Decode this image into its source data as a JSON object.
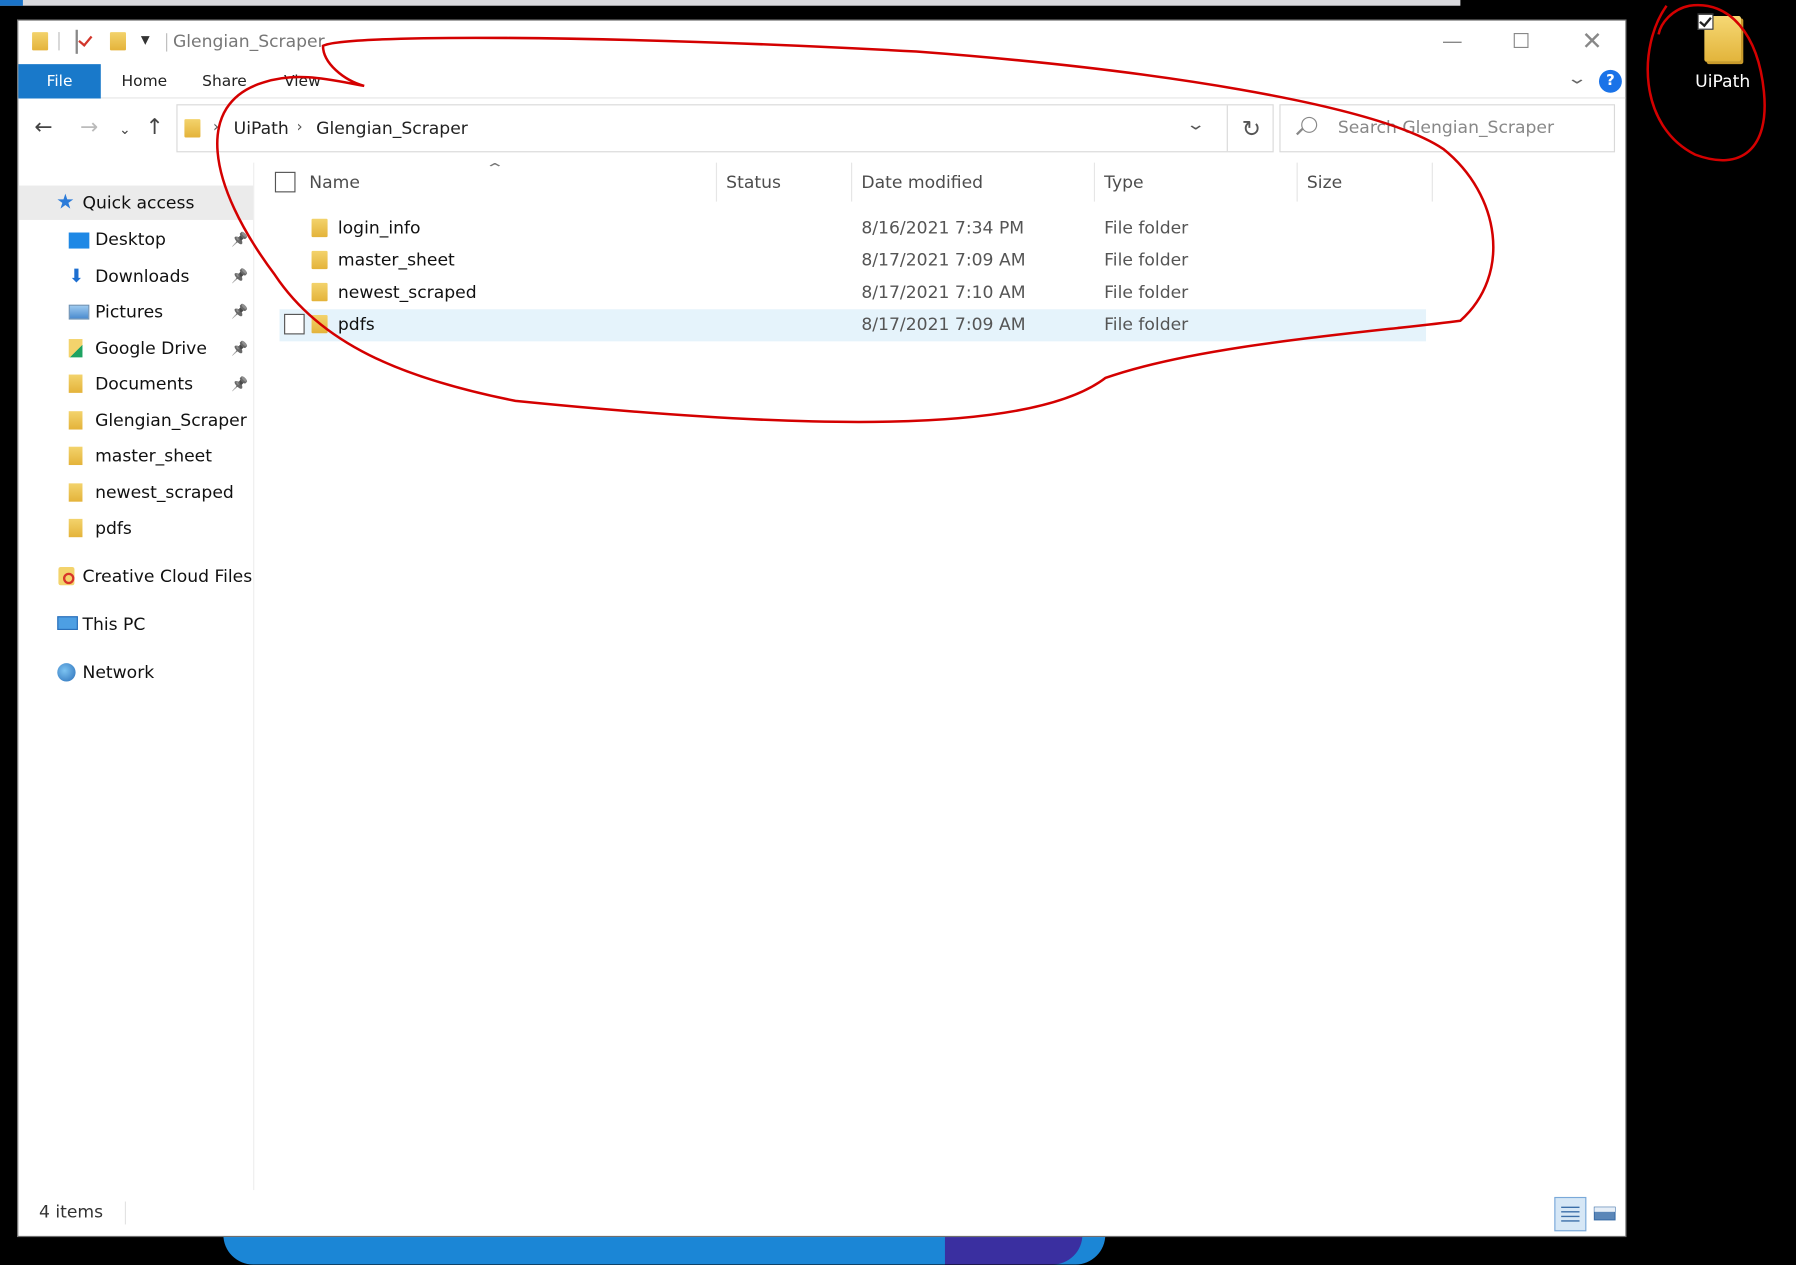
{
  "window": {
    "title": "Glengian_Scraper"
  },
  "ribbon": {
    "tabs": [
      "File",
      "Home",
      "Share",
      "View"
    ]
  },
  "address": {
    "crumbs": [
      "UiPath",
      "Glengian_Scraper"
    ]
  },
  "search": {
    "placeholder": "Search Glengian_Scraper"
  },
  "sidebar": {
    "quick_access": "Quick access",
    "items": [
      {
        "label": "Desktop",
        "icon": "desktop-icon",
        "pinned": true
      },
      {
        "label": "Downloads",
        "icon": "download-icon",
        "pinned": true
      },
      {
        "label": "Pictures",
        "icon": "pictures-icon",
        "pinned": true
      },
      {
        "label": "Google Drive",
        "icon": "google-drive-icon",
        "pinned": true
      },
      {
        "label": "Documents",
        "icon": "documents-icon",
        "pinned": true
      },
      {
        "label": "Glengian_Scraper",
        "icon": "folder-icon",
        "pinned": false
      },
      {
        "label": "master_sheet",
        "icon": "folder-icon",
        "pinned": false
      },
      {
        "label": "newest_scraped",
        "icon": "folder-icon",
        "pinned": false
      },
      {
        "label": "pdfs",
        "icon": "folder-icon",
        "pinned": false
      }
    ],
    "creative_cloud": "Creative Cloud Files",
    "this_pc": "This PC",
    "network": "Network"
  },
  "columns": [
    "Name",
    "Status",
    "Date modified",
    "Type",
    "Size"
  ],
  "files": [
    {
      "name": "login_info",
      "date": "8/16/2021 7:34 PM",
      "type": "File folder"
    },
    {
      "name": "master_sheet",
      "date": "8/17/2021 7:09 AM",
      "type": "File folder"
    },
    {
      "name": "newest_scraped",
      "date": "8/17/2021 7:10 AM",
      "type": "File folder"
    },
    {
      "name": "pdfs",
      "date": "8/17/2021 7:09 AM",
      "type": "File folder"
    }
  ],
  "status": {
    "count": "4 items"
  },
  "desktop": {
    "icon_label": "UiPath"
  },
  "colors": {
    "accent": "#1979ca",
    "annotation": "#d40000",
    "selection": "#e5f3fb"
  }
}
